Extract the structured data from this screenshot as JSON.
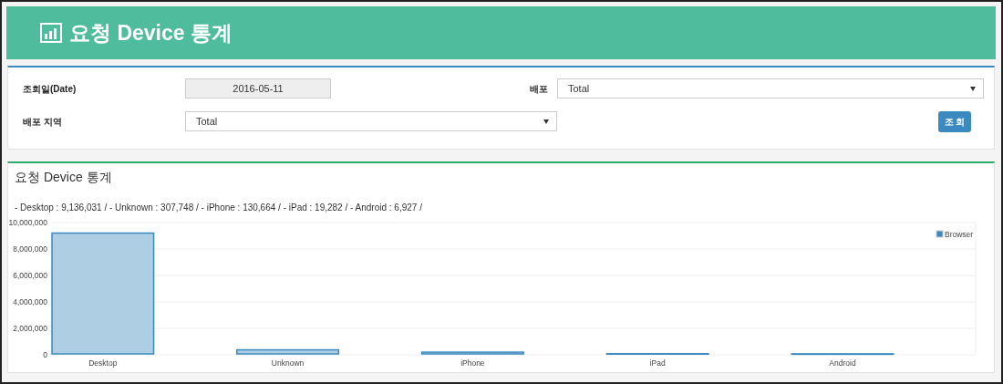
{
  "header": {
    "title": "요청 Device 통계"
  },
  "filters": {
    "date_label": "조회일(Date)",
    "date_value": "2016-05-11",
    "deploy_label": "배포",
    "deploy_value": "Total",
    "region_label": "배포 지역",
    "region_value": "Total",
    "search_button": "조 회"
  },
  "stats": {
    "title": "요청 Device 통계",
    "summary": "- Desktop : 9,136,031 / - Unknown : 307,748 / - iPhone : 130,664 / - iPad : 19,282 / - Android : 6,927 /",
    "chart_data": {
      "type": "bar",
      "categories": [
        "Desktop",
        "Unknown",
        "iPhone",
        "iPad",
        "Android"
      ],
      "series": [
        {
          "name": "Browser",
          "color": "#3a8abf",
          "values": [
            9136031,
            307748,
            130664,
            19282,
            6927
          ]
        }
      ],
      "grid": true,
      "ylim": [
        0,
        10000000
      ],
      "yticks": [
        {
          "value": 0,
          "label": "0"
        },
        {
          "value": 2000000,
          "label": "2,000,000"
        },
        {
          "value": 4000000,
          "label": "4,000,000"
        },
        {
          "value": 6000000,
          "label": "6,000,000"
        },
        {
          "value": 8000000,
          "label": "8,000,000"
        },
        {
          "value": 10000000,
          "label": "10,000,000"
        }
      ]
    }
  }
}
